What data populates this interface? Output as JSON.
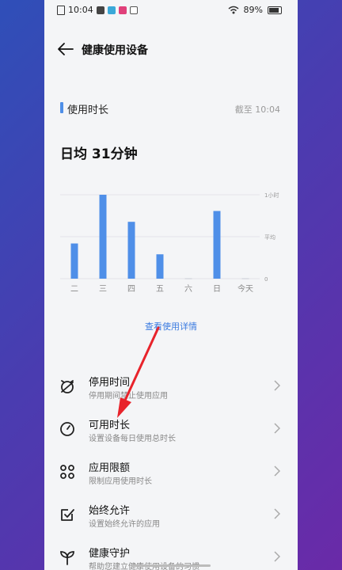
{
  "status": {
    "time": "10:04",
    "battery": "89%"
  },
  "header": {
    "title": "健康使用设备"
  },
  "usage": {
    "section_title": "使用时长",
    "as_of": "截至 10:04",
    "daily_avg": "日均 31分钟"
  },
  "chart_data": {
    "type": "bar",
    "categories": [
      "二",
      "三",
      "四",
      "五",
      "六",
      "日",
      "今天"
    ],
    "values": [
      26,
      62,
      42,
      18,
      0,
      50,
      0
    ],
    "ylim": [
      0,
      62
    ],
    "ytick_labels": [
      "1小时",
      "平均",
      "0"
    ],
    "ytick_values": [
      62,
      31,
      0
    ],
    "color": "#4f8fe8"
  },
  "detail_link": "查看使用详情",
  "items": [
    {
      "title": "停用时间",
      "subtitle": "停用期间禁止使用应用",
      "icon": "moon-clock-icon"
    },
    {
      "title": "可用时长",
      "subtitle": "设置设备每日使用总时长",
      "icon": "clock-icon"
    },
    {
      "title": "应用限额",
      "subtitle": "限制应用使用时长",
      "icon": "apps-grid-icon"
    },
    {
      "title": "始终允许",
      "subtitle": "设置始终允许的应用",
      "icon": "check-box-icon"
    },
    {
      "title": "健康守护",
      "subtitle": "帮助您建立健康使用设备的习惯",
      "icon": "sprout-icon"
    }
  ]
}
